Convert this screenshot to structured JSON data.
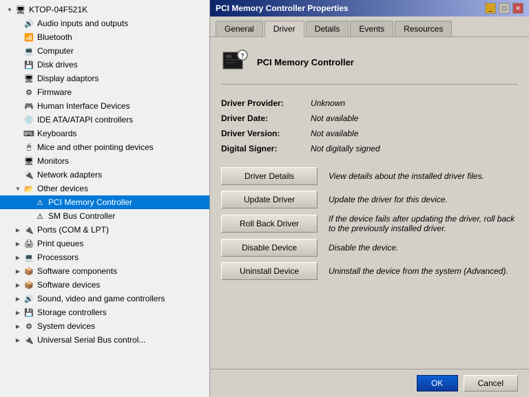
{
  "window": {
    "title": "PCI Memory Controller Properties"
  },
  "left_panel": {
    "items": [
      {
        "id": "ktop",
        "label": "KTOP-04F521K",
        "indent": 0,
        "has_expand": false,
        "expanded": true
      },
      {
        "id": "audio",
        "label": "Audio inputs and outputs",
        "indent": 1,
        "has_expand": false
      },
      {
        "id": "bluetooth",
        "label": "Bluetooth",
        "indent": 1,
        "has_expand": false
      },
      {
        "id": "computer",
        "label": "Computer",
        "indent": 1,
        "has_expand": false
      },
      {
        "id": "disk",
        "label": "Disk drives",
        "indent": 1,
        "has_expand": false
      },
      {
        "id": "display",
        "label": "Display adaptors",
        "indent": 1,
        "has_expand": false
      },
      {
        "id": "firmware",
        "label": "Firmware",
        "indent": 1,
        "has_expand": false
      },
      {
        "id": "hid",
        "label": "Human Interface Devices",
        "indent": 1,
        "has_expand": false
      },
      {
        "id": "ide",
        "label": "IDE ATA/ATAPI controllers",
        "indent": 1,
        "has_expand": false
      },
      {
        "id": "keyboards",
        "label": "Keyboards",
        "indent": 1,
        "has_expand": false
      },
      {
        "id": "mice",
        "label": "Mice and other pointing devices",
        "indent": 1,
        "has_expand": false
      },
      {
        "id": "monitors",
        "label": "Monitors",
        "indent": 1,
        "has_expand": false
      },
      {
        "id": "network",
        "label": "Network adapters",
        "indent": 1,
        "has_expand": false
      },
      {
        "id": "other",
        "label": "Other devices",
        "indent": 1,
        "has_expand": true,
        "expanded": true
      },
      {
        "id": "pci",
        "label": "PCI Memory Controller",
        "indent": 2,
        "has_expand": false,
        "selected": true,
        "warning": true
      },
      {
        "id": "smbus",
        "label": "SM Bus Controller",
        "indent": 2,
        "has_expand": false,
        "warning": true
      },
      {
        "id": "ports",
        "label": "Ports (COM & LPT)",
        "indent": 1,
        "has_expand": true
      },
      {
        "id": "print",
        "label": "Print queues",
        "indent": 1,
        "has_expand": true
      },
      {
        "id": "processors",
        "label": "Processors",
        "indent": 1,
        "has_expand": true
      },
      {
        "id": "softcomp",
        "label": "Software components",
        "indent": 1,
        "has_expand": true
      },
      {
        "id": "softdev",
        "label": "Software devices",
        "indent": 1,
        "has_expand": true
      },
      {
        "id": "sound",
        "label": "Sound, video and game controllers",
        "indent": 1,
        "has_expand": true
      },
      {
        "id": "storage",
        "label": "Storage controllers",
        "indent": 1,
        "has_expand": true
      },
      {
        "id": "system",
        "label": "System devices",
        "indent": 1,
        "has_expand": true
      },
      {
        "id": "universal",
        "label": "Universal Serial Bus control...",
        "indent": 1,
        "has_expand": true
      }
    ]
  },
  "dialog": {
    "title": "PCI Memory Controller Properties",
    "tabs": [
      {
        "id": "general",
        "label": "General"
      },
      {
        "id": "driver",
        "label": "Driver",
        "active": true
      },
      {
        "id": "details",
        "label": "Details"
      },
      {
        "id": "events",
        "label": "Events"
      },
      {
        "id": "resources",
        "label": "Resources"
      }
    ],
    "device_name": "PCI Memory Controller",
    "driver_info": {
      "provider_label": "Driver Provider:",
      "provider_value": "Unknown",
      "date_label": "Driver Date:",
      "date_value": "Not available",
      "version_label": "Driver Version:",
      "version_value": "Not available",
      "signer_label": "Digital Signer:",
      "signer_value": "Not digitally signed"
    },
    "buttons": [
      {
        "id": "driver-details",
        "label": "Driver Details",
        "description": "View details about the installed driver files."
      },
      {
        "id": "update-driver",
        "label": "Update Driver",
        "description": "Update the driver for this device."
      },
      {
        "id": "roll-back",
        "label": "Roll Back Driver",
        "description": "If the device fails after updating the driver, roll back to the previously installed driver."
      },
      {
        "id": "disable-device",
        "label": "Disable Device",
        "description": "Disable the device."
      },
      {
        "id": "uninstall-device",
        "label": "Uninstall Device",
        "description": "Uninstall the device from the system (Advanced)."
      }
    ],
    "footer": {
      "ok_label": "OK",
      "cancel_label": "Cancel"
    }
  }
}
